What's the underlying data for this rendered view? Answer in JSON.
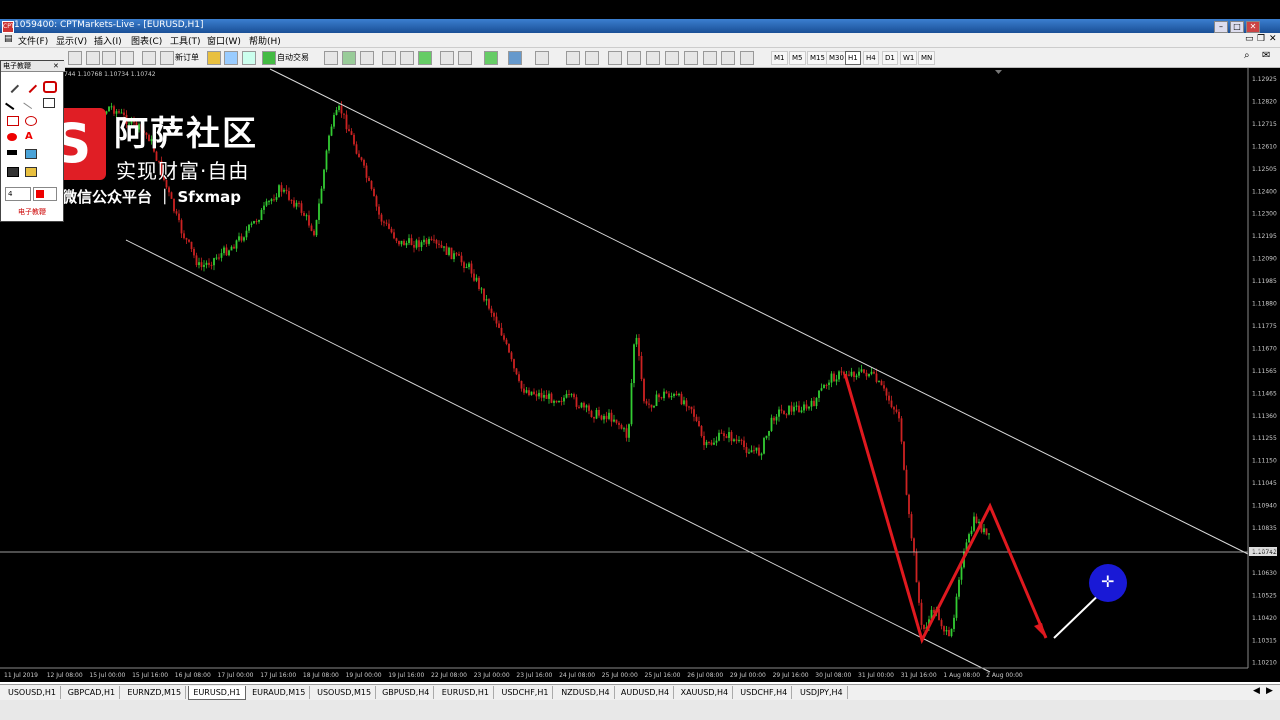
{
  "window": {
    "title": "1059400: CPTMarkets-Live - [EURUSD,H1]",
    "app_icon_text": "CPT"
  },
  "menu": [
    "文件(F)",
    "显示(V)",
    "插入(I)",
    "图表(C)",
    "工具(T)",
    "窗口(W)",
    "帮助(H)"
  ],
  "toolbar": {
    "new_order": "新订单",
    "auto_trading": "自动交易",
    "timeframes": [
      "M1",
      "M5",
      "M15",
      "M30",
      "H1",
      "H4",
      "D1",
      "W1",
      "MN"
    ],
    "active_timeframe": "H1"
  },
  "chart_info": {
    "ohlc_text": "744 1.10768 1.10734 1.10742",
    "current_price": "1.10742"
  },
  "price_axis": [
    "1.12925",
    "1.12820",
    "1.12715",
    "1.12610",
    "1.12505",
    "1.12400",
    "1.12300",
    "1.12195",
    "1.12090",
    "1.11985",
    "1.11880",
    "1.11775",
    "1.11670",
    "1.11565",
    "1.11465",
    "1.11360",
    "1.11255",
    "1.11150",
    "1.11045",
    "1.10940",
    "1.10835",
    "1.10730",
    "1.10630",
    "1.10525",
    "1.10420",
    "1.10315",
    "1.10210"
  ],
  "time_axis": [
    "11 Jul 2019",
    "12 Jul 08:00",
    "15 Jul 00:00",
    "15 Jul 16:00",
    "16 Jul 08:00",
    "17 Jul 00:00",
    "17 Jul 16:00",
    "18 Jul 08:00",
    "19 Jul 00:00",
    "19 Jul 16:00",
    "22 Jul 08:00",
    "23 Jul 00:00",
    "23 Jul 16:00",
    "24 Jul 08:00",
    "25 Jul 00:00",
    "25 Jul 16:00",
    "26 Jul 08:00",
    "29 Jul 00:00",
    "29 Jul 16:00",
    "30 Jul 08:00",
    "31 Jul 00:00",
    "31 Jul 16:00",
    "1 Aug 08:00",
    "2 Aug 00:00"
  ],
  "toolpanel": {
    "title": "电子教鞭",
    "footer": "电子教鞭",
    "width_value": "4"
  },
  "watermark": {
    "logo_letter": "S",
    "brand": "阿萨社区",
    "slogan": "实现财富·自由",
    "platform": "微信公众平台 ｜ Sfxmap"
  },
  "tabs": [
    "USOUSD,H1",
    "GBPCAD,H1",
    "EURNZD,M15",
    "EURUSD,H1",
    "EURAUD,M15",
    "USOUSD,M15",
    "GBPUSD,H4",
    "EURUSD,H1",
    "USDCHF,H1",
    "NZDUSD,H4",
    "AUDUSD,H4",
    "XAUUSD,H4",
    "USDCHF,H4",
    "USDJPY,H4"
  ],
  "active_tab_index": 3,
  "colors": {
    "chart_bg": "#000000",
    "bull": "#33cc33",
    "bear": "#cc2222",
    "annotation_red": "#e0191f",
    "annotation_white": "#ffffff",
    "channel": "#d9d9d9",
    "cursor_circle": "#1919d6"
  }
}
